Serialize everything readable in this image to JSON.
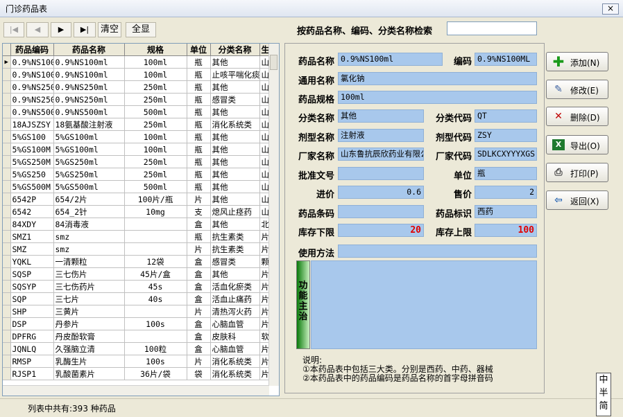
{
  "window": {
    "title": "门诊药品表",
    "close": "×"
  },
  "toolbar": {
    "first": "|◀",
    "prev": "◀",
    "next": "▶",
    "last": "▶|",
    "clear_label": "清空",
    "show_all_label": "全显"
  },
  "search": {
    "label": "按药品名称、编码、分类名称检索",
    "value": ""
  },
  "table": {
    "columns": [
      "药品编码",
      "药品名称",
      "规格",
      "单位",
      "分类名称",
      "生"
    ],
    "rows": [
      [
        "0.9%NS100",
        "0.9%NS100ml",
        "100ml",
        "瓶",
        "其他",
        "山"
      ],
      [
        "0.9%NS100",
        "0.9%NS100ml",
        "100ml",
        "瓶",
        "止咳平喘化痰",
        "山"
      ],
      [
        "0.9%NS250",
        "0.9%NS250ml",
        "250ml",
        "瓶",
        "其他",
        "山"
      ],
      [
        "0.9%NS250",
        "0.9%NS250ml",
        "250ml",
        "瓶",
        "感冒类",
        "山"
      ],
      [
        "0.9%NS500",
        "0.9%NS500ml",
        "500ml",
        "瓶",
        "其他",
        "山"
      ],
      [
        "18AJSZSY",
        "18氨基酸注射液",
        "250ml",
        "瓶",
        "消化系统类",
        "山"
      ],
      [
        "5%GS100",
        "5%GS100ml",
        "100ml",
        "瓶",
        "其他",
        "山"
      ],
      [
        "5%GS100M",
        "5%GS100ml",
        "100ml",
        "瓶",
        "其他",
        "山"
      ],
      [
        "5%GS250M",
        "5%GS250ml",
        "250ml",
        "瓶",
        "其他",
        "山"
      ],
      [
        "5%GS250",
        "5%GS250ml",
        "250ml",
        "瓶",
        "其他",
        "山"
      ],
      [
        "5%GS500M",
        "5%GS500ml",
        "500ml",
        "瓶",
        "其他",
        "山"
      ],
      [
        "6542P",
        "654/2片",
        "100片/瓶",
        "片",
        "其他",
        "山"
      ],
      [
        "6542",
        "654_2针",
        "10mg",
        "支",
        "熄风止痉药",
        "山"
      ],
      [
        "84XDY",
        "84消毒液",
        "",
        "盒",
        "其他",
        "北"
      ],
      [
        "SMZ1",
        "smz",
        "",
        "瓶",
        "抗生素类",
        "片"
      ],
      [
        "SMZ",
        "smz",
        "",
        "片",
        "抗生素类",
        "片"
      ],
      [
        "YQKL",
        "一清颗粒",
        "12袋",
        "盒",
        "感冒类",
        "颗"
      ],
      [
        "SQSP",
        "三七伤片",
        "45片/盒",
        "盒",
        "其他",
        "片"
      ],
      [
        "SQSYP",
        "三七伤药片",
        "45s",
        "盒",
        "活血化瘀类",
        "片"
      ],
      [
        "SQP",
        "三七片",
        "40s",
        "盒",
        "活血止痛药",
        "片"
      ],
      [
        "SHP",
        "三黄片",
        "",
        "片",
        "清热泻火药",
        "片"
      ],
      [
        "DSP",
        "丹参片",
        "100s",
        "盒",
        "心脑血管",
        "片"
      ],
      [
        "DPFRG",
        "丹皮酚软膏",
        "",
        "盒",
        "皮肤科",
        "软"
      ],
      [
        "JQNLQ",
        "久强脑立清",
        "100粒",
        "盒",
        "心脑血管",
        "片"
      ],
      [
        "RMSP",
        "乳酶生片",
        "100s",
        "片",
        "消化系统类",
        "片"
      ],
      [
        "RJSP1",
        "乳酸菌素片",
        "36片/袋",
        "袋",
        "消化系统类",
        "片"
      ]
    ]
  },
  "status": {
    "text": "列表中共有:393 种药品"
  },
  "form": {
    "drug_name": {
      "label": "药品名称",
      "value": "0.9%NS100ml"
    },
    "code": {
      "label": "编码",
      "value": "0.9%NS100ML"
    },
    "generic_name": {
      "label": "通用名称",
      "value": "氯化钠"
    },
    "spec": {
      "label": "药品规格",
      "value": "100ml"
    },
    "category_name": {
      "label": "分类名称",
      "value": "其他"
    },
    "category_code": {
      "label": "分类代码",
      "value": "QT"
    },
    "form_name": {
      "label": "剂型名称",
      "value": "注射液"
    },
    "form_code": {
      "label": "剂型代码",
      "value": "ZSY"
    },
    "manufacturer": {
      "label": "厂家名称",
      "value": "山东鲁抗辰欣药业有限公司"
    },
    "manufacturer_code": {
      "label": "厂家代码",
      "value": "SDLKCXYYYXGS"
    },
    "approval_no": {
      "label": "批准文号",
      "value": ""
    },
    "unit": {
      "label": "单位",
      "value": "瓶"
    },
    "purchase_price": {
      "label": "进价",
      "value": "0.6"
    },
    "sale_price": {
      "label": "售价",
      "value": "2"
    },
    "barcode": {
      "label": "药品条码",
      "value": ""
    },
    "drug_type": {
      "label": "药品标识",
      "value": "西药"
    },
    "stock_min": {
      "label": "库存下限",
      "value": "20"
    },
    "stock_max": {
      "label": "库存上限",
      "value": "100"
    },
    "usage": {
      "label": "使用方法",
      "value": ""
    },
    "function_label": "功能主治",
    "function_value": ""
  },
  "note": {
    "line1": "说明:",
    "line2": "①本药品表中包括三大类。分别是西药、中药、器械",
    "line3": "②本药品表中的药品编码是药品名称的首字母拼音码"
  },
  "actions": {
    "add": "添加(N)",
    "edit": "修改(E)",
    "delete": "删除(D)",
    "export": "导出(O)",
    "print": "打印(P)",
    "back": "返回(X)"
  },
  "ime": {
    "chars": [
      "中",
      "半",
      "简"
    ]
  }
}
